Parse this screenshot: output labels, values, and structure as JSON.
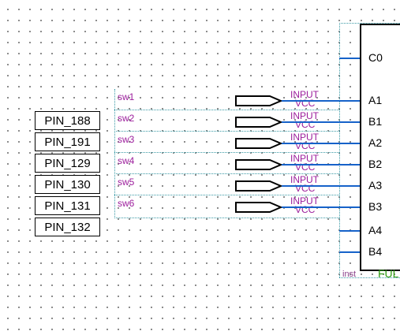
{
  "pins": [
    "PIN_188",
    "PIN_191",
    "PIN_129",
    "PIN_130",
    "PIN_131",
    "PIN_132"
  ],
  "signals": [
    "sw1",
    "sw2",
    "sw3",
    "sw4",
    "sw5",
    "sw6"
  ],
  "input_label": "INPUT",
  "vcc_label": "VCC",
  "ports": [
    "C0",
    "A1",
    "B1",
    "A2",
    "B2",
    "A3",
    "B3",
    "A4",
    "B4"
  ],
  "instance": {
    "label": "inst",
    "name": "FUL"
  },
  "colors": {
    "wire": "#1662c9",
    "signal_text": "#9c1d9c",
    "dotted_border": "#3a9aa6",
    "inst_name": "#2b9a0e"
  }
}
